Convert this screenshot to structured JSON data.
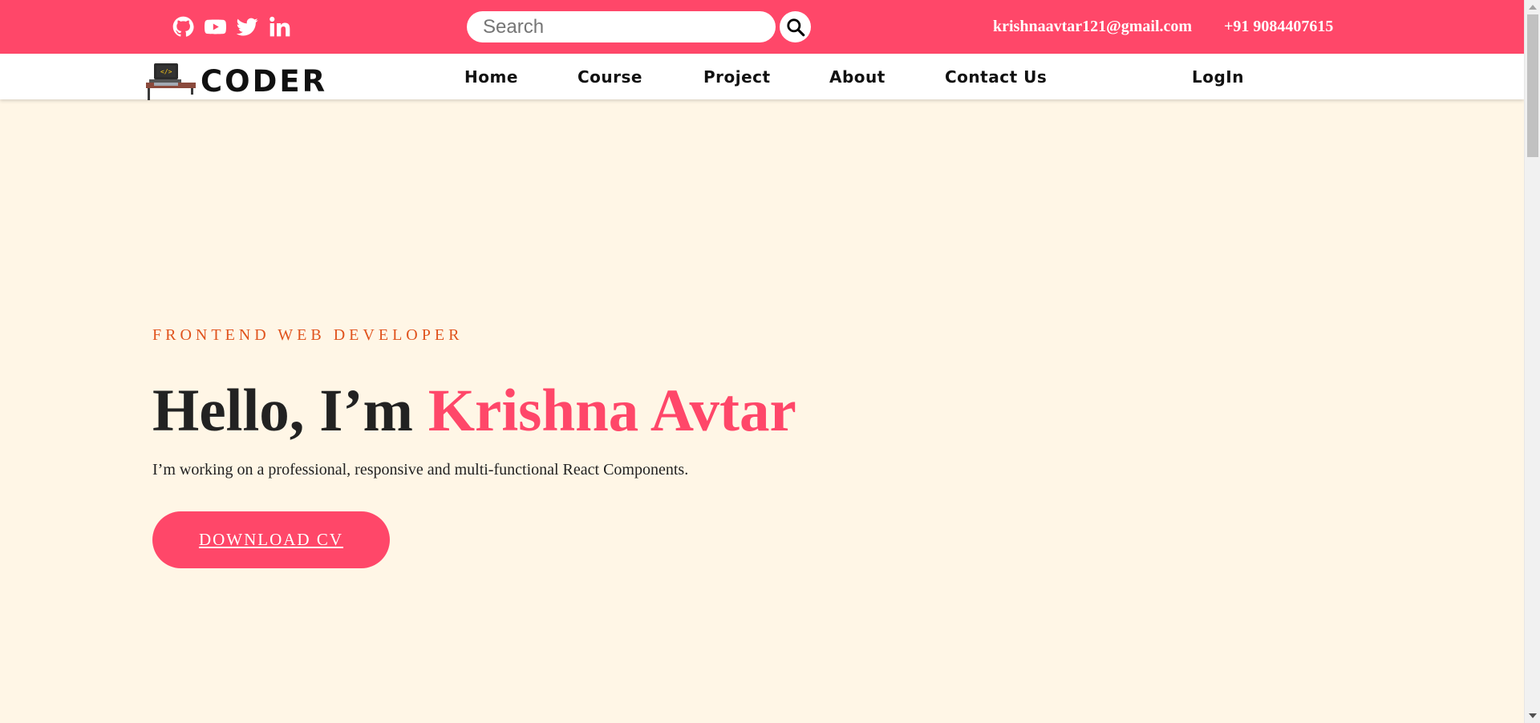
{
  "topbar": {
    "social": [
      {
        "name": "github-icon"
      },
      {
        "name": "youtube-icon"
      },
      {
        "name": "twitter-icon"
      },
      {
        "name": "linkedin-icon"
      }
    ],
    "search": {
      "placeholder": "Search",
      "value": ""
    },
    "email": "krishnaavtar121@gmail.com",
    "phone": "+91 9084407615"
  },
  "navbar": {
    "brand": "CODER",
    "items": [
      "Home",
      "Course",
      "Project",
      "About",
      "Contact Us"
    ],
    "login": "LogIn"
  },
  "hero": {
    "eyebrow": "FRONTEND WEB DEVELOPER",
    "greeting": "Hello, I’m ",
    "name": "Krishna Avtar",
    "description": "I’m working on a professional, responsive and multi-functional React Components.",
    "cta": "DOWNLOAD CV"
  },
  "colors": {
    "accent": "#ff4769",
    "background": "#fff6e6",
    "eyebrow": "#e0531d"
  }
}
